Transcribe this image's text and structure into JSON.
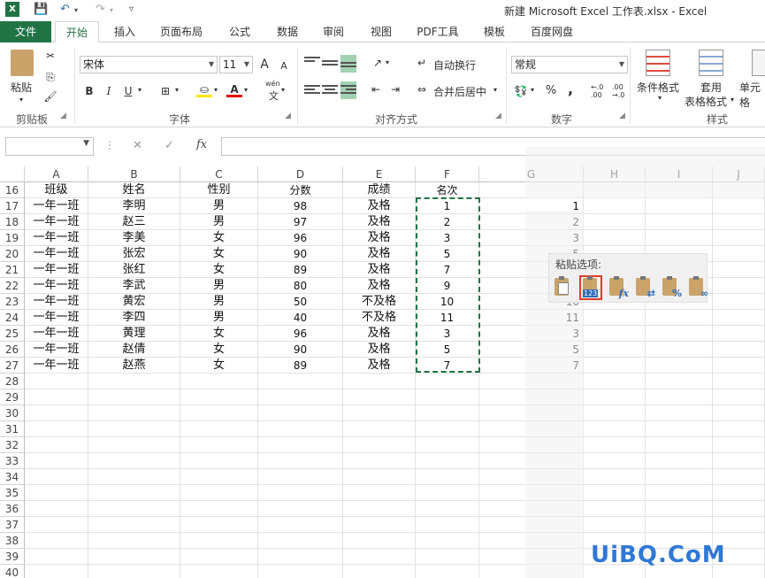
{
  "window": {
    "title": "新建 Microsoft Excel 工作表.xlsx - Excel"
  },
  "tabs": [
    {
      "label": "文件"
    },
    {
      "label": "开始"
    },
    {
      "label": "插入"
    },
    {
      "label": "页面布局"
    },
    {
      "label": "公式"
    },
    {
      "label": "数据"
    },
    {
      "label": "审阅"
    },
    {
      "label": "视图"
    },
    {
      "label": "PDF工具"
    },
    {
      "label": "模板"
    },
    {
      "label": "百度网盘"
    }
  ],
  "ribbon": {
    "paste_label": "粘贴",
    "font_name": "宋体",
    "font_size": "11",
    "wrap_text": "自动换行",
    "merge_center": "合并后居中",
    "number_format": "常规",
    "conditional_format": "条件格式",
    "table_format_1": "套用",
    "table_format_2": "表格格式",
    "cell_styles": "单元格",
    "groups": [
      "剪贴板",
      "字体",
      "对齐方式",
      "数字",
      "样式"
    ],
    "bold": "B",
    "italic": "I",
    "underline": "U",
    "percent": "%",
    "comma": ",",
    "font_grow": "A",
    "font_shrink": "A",
    "wen": "wén",
    "wen2": "文",
    "font_color": "A",
    "dec_inc": "←.0 .00",
    "dec_dec": ".00 →.0"
  },
  "formula_bar": {
    "fx_label": "fx",
    "cancel": "✕",
    "confirm": "✓",
    "dots": "⋮",
    "value": ""
  },
  "columns": [
    "A",
    "B",
    "C",
    "D",
    "E",
    "F",
    "G",
    "H",
    "I",
    "J"
  ],
  "rows": [
    {
      "n": "16",
      "A": "班级",
      "B": "姓名",
      "C": "性别",
      "D": "分数",
      "E": "成绩",
      "F": "名次",
      "G": ""
    },
    {
      "n": "17",
      "A": "一年一班",
      "B": "李明",
      "C": "男",
      "D": "98",
      "E": "及格",
      "F": "1",
      "G": "1"
    },
    {
      "n": "18",
      "A": "一年一班",
      "B": "赵三",
      "C": "男",
      "D": "97",
      "E": "及格",
      "F": "2",
      "G": "2"
    },
    {
      "n": "19",
      "A": "一年一班",
      "B": "李美",
      "C": "女",
      "D": "96",
      "E": "及格",
      "F": "3",
      "G": "3"
    },
    {
      "n": "20",
      "A": "一年一班",
      "B": "张宏",
      "C": "女",
      "D": "90",
      "E": "及格",
      "F": "5",
      "G": "5"
    },
    {
      "n": "21",
      "A": "一年一班",
      "B": "张红",
      "C": "女",
      "D": "89",
      "E": "及格",
      "F": "7",
      "G": ""
    },
    {
      "n": "22",
      "A": "一年一班",
      "B": "李武",
      "C": "男",
      "D": "80",
      "E": "及格",
      "F": "9",
      "G": ""
    },
    {
      "n": "23",
      "A": "一年一班",
      "B": "黄宏",
      "C": "男",
      "D": "50",
      "E": "不及格",
      "F": "10",
      "G": "10"
    },
    {
      "n": "24",
      "A": "一年一班",
      "B": "李四",
      "C": "男",
      "D": "40",
      "E": "不及格",
      "F": "11",
      "G": "11"
    },
    {
      "n": "25",
      "A": "一年一班",
      "B": "黄理",
      "C": "女",
      "D": "96",
      "E": "及格",
      "F": "3",
      "G": "3"
    },
    {
      "n": "26",
      "A": "一年一班",
      "B": "赵倩",
      "C": "女",
      "D": "90",
      "E": "及格",
      "F": "5",
      "G": "5"
    },
    {
      "n": "27",
      "A": "一年一班",
      "B": "赵燕",
      "C": "女",
      "D": "89",
      "E": "及格",
      "F": "7",
      "G": "7"
    },
    {
      "n": "28"
    },
    {
      "n": "29"
    },
    {
      "n": "30"
    },
    {
      "n": "31"
    },
    {
      "n": "32"
    },
    {
      "n": "33"
    },
    {
      "n": "34"
    },
    {
      "n": "35"
    },
    {
      "n": "36"
    },
    {
      "n": "37"
    },
    {
      "n": "38"
    },
    {
      "n": "39"
    },
    {
      "n": "40"
    }
  ],
  "paste_options": {
    "title": "粘贴选项:",
    "buttons": [
      {
        "name": "paste-default",
        "glyph": ""
      },
      {
        "name": "paste-values",
        "glyph": "123"
      },
      {
        "name": "paste-formulas",
        "glyph": "fx"
      },
      {
        "name": "paste-link-format",
        "glyph": "⇄"
      },
      {
        "name": "paste-formatting",
        "glyph": "%"
      },
      {
        "name": "paste-link",
        "glyph": "∞"
      }
    ],
    "selected_index": 1
  },
  "colors": {
    "excel_green": "#217346",
    "selected_highlight": "#e23b2e"
  },
  "watermark": "UiBQ.CoM"
}
